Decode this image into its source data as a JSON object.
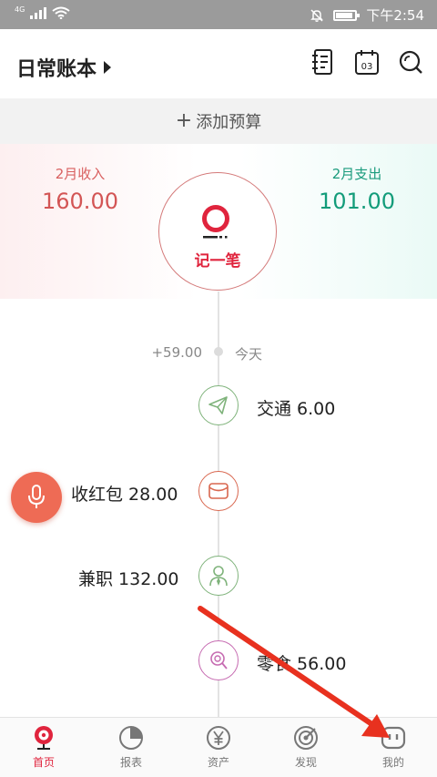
{
  "status_bar": {
    "network": "4G",
    "time": "下午2:54"
  },
  "header": {
    "book_name": "日常账本"
  },
  "budget": {
    "plus": "+",
    "label": "添加预算"
  },
  "summary": {
    "income_label": "2月收入",
    "income_value": "160.00",
    "expense_label": "2月支出",
    "expense_value": "101.00"
  },
  "record_button": {
    "label": "记一笔"
  },
  "timeline": {
    "day_total": "+59.00",
    "day_label": "今天",
    "entries": [
      {
        "text": "交通 6.00",
        "icon": "paper-plane-icon",
        "color": "#7fb37b",
        "side": "right"
      },
      {
        "text": "收红包 28.00",
        "icon": "envelope-icon",
        "color": "#d9674f",
        "side": "left"
      },
      {
        "text": "兼职 132.00",
        "icon": "worker-icon",
        "color": "#7fb37b",
        "side": "left"
      },
      {
        "text": "零食 56.00",
        "icon": "lollipop-icon",
        "color": "#c66bb1",
        "side": "right"
      }
    ]
  },
  "bottom_nav": [
    {
      "label": "首页",
      "icon": "home-pin-icon",
      "active": true
    },
    {
      "label": "报表",
      "icon": "pie-chart-icon",
      "active": false
    },
    {
      "label": "资产",
      "icon": "yen-coin-icon",
      "active": false
    },
    {
      "label": "发现",
      "icon": "target-icon",
      "active": false
    },
    {
      "label": "我的",
      "icon": "profile-face-icon",
      "active": false
    }
  ],
  "colors": {
    "accent": "#e0243d",
    "income": "#d35555",
    "expense": "#139c7a",
    "annotation_arrow": "#e8311f"
  }
}
